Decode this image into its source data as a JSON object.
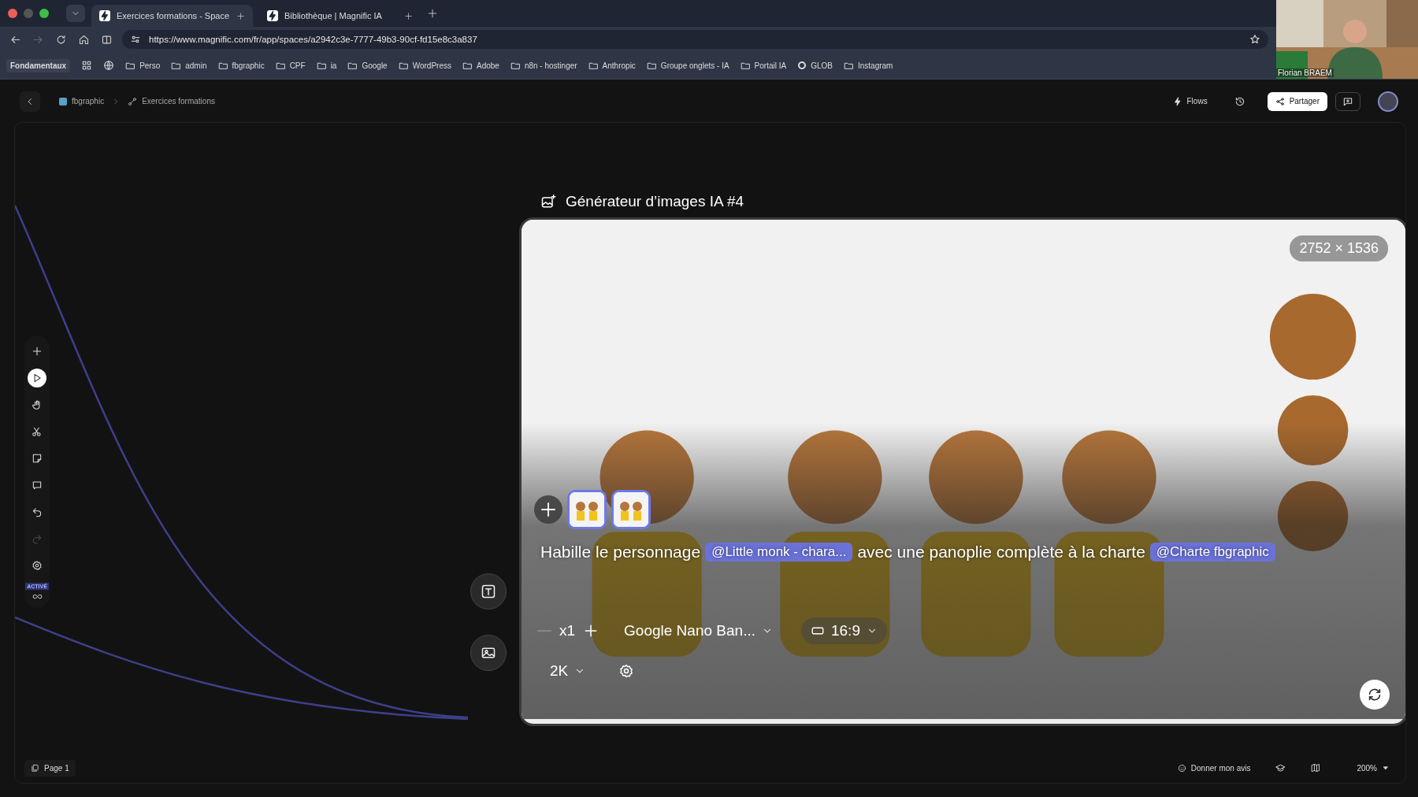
{
  "browser": {
    "tabs": [
      {
        "title": "Exercices formations - Space",
        "selected": true
      },
      {
        "title": "Bibliothèque | Magnific IA",
        "selected": false
      }
    ],
    "nav_buttons": [
      {
        "kind": "back",
        "disabled": false
      },
      {
        "kind": "forward",
        "disabled": true
      },
      {
        "kind": "reload",
        "disabled": false
      },
      {
        "kind": "home",
        "disabled": false
      },
      {
        "kind": "sidebar",
        "disabled": false
      }
    ],
    "url": "https://www.magnific.com/fr/app/spaces/a2942c3e-7777-49b3-90cf-fd15e8c3a837",
    "bookmarks": [
      {
        "kind": "chip",
        "label": "Fondamentaux"
      },
      {
        "kind": "apps"
      },
      {
        "kind": "globe"
      },
      {
        "kind": "folder",
        "label": "Perso"
      },
      {
        "kind": "folder",
        "label": "admin"
      },
      {
        "kind": "folder",
        "label": "fbgraphic"
      },
      {
        "kind": "folder",
        "label": "CPF"
      },
      {
        "kind": "folder",
        "label": "ia"
      },
      {
        "kind": "folder",
        "label": "Google"
      },
      {
        "kind": "folder",
        "label": "WordPress"
      },
      {
        "kind": "folder",
        "label": "Adobe"
      },
      {
        "kind": "folder",
        "label": "n8n - hostinger"
      },
      {
        "kind": "folder",
        "label": "Anthropic"
      },
      {
        "kind": "folder",
        "label": "Groupe onglets - IA"
      },
      {
        "kind": "folder",
        "label": "Portail IA"
      },
      {
        "kind": "site",
        "label": "GLOB"
      },
      {
        "kind": "folder",
        "label": "Instagram"
      }
    ]
  },
  "webcam": {
    "caption": "Florian BRAEM"
  },
  "header": {
    "breadcrumb": [
      {
        "kind": "space",
        "label": "fbgraphic"
      },
      {
        "kind": "flow",
        "label": "Exercices formations"
      }
    ],
    "flows": "Flows",
    "share": "Partager"
  },
  "tools": [
    {
      "kind": "plus",
      "selected": false,
      "disabled": false
    },
    {
      "kind": "pointer",
      "selected": true,
      "disabled": false
    },
    {
      "kind": "hand",
      "selected": false,
      "disabled": false
    },
    {
      "kind": "scissors",
      "selected": false,
      "disabled": false
    },
    {
      "kind": "note",
      "selected": false,
      "disabled": false
    },
    {
      "kind": "comment",
      "selected": false,
      "disabled": false
    },
    {
      "kind": "undo",
      "selected": false,
      "disabled": false
    },
    {
      "kind": "redo",
      "selected": false,
      "disabled": true
    },
    {
      "kind": "settings",
      "selected": false,
      "disabled": false
    }
  ],
  "mode_badge": "ACTIVÉ",
  "node": {
    "title": "Générateur d’images IA #4",
    "size": "2752 × 1536",
    "prompt": [
      {
        "kind": "text",
        "text": "Habille le personnage"
      },
      {
        "kind": "mention",
        "text": "@Little monk - chara..."
      },
      {
        "kind": "text",
        "text": "avec une panoplie complète à la charte"
      },
      {
        "kind": "mention",
        "text": "@Charte fbgraphic"
      }
    ],
    "decrement_disabled": true,
    "count": "x1",
    "model": "Google Nano Ban...",
    "ratio": "16:9",
    "resolution": "2K"
  },
  "footer": {
    "page": "Page 1",
    "feedback": "Donner mon avis",
    "zoom": "200%"
  }
}
